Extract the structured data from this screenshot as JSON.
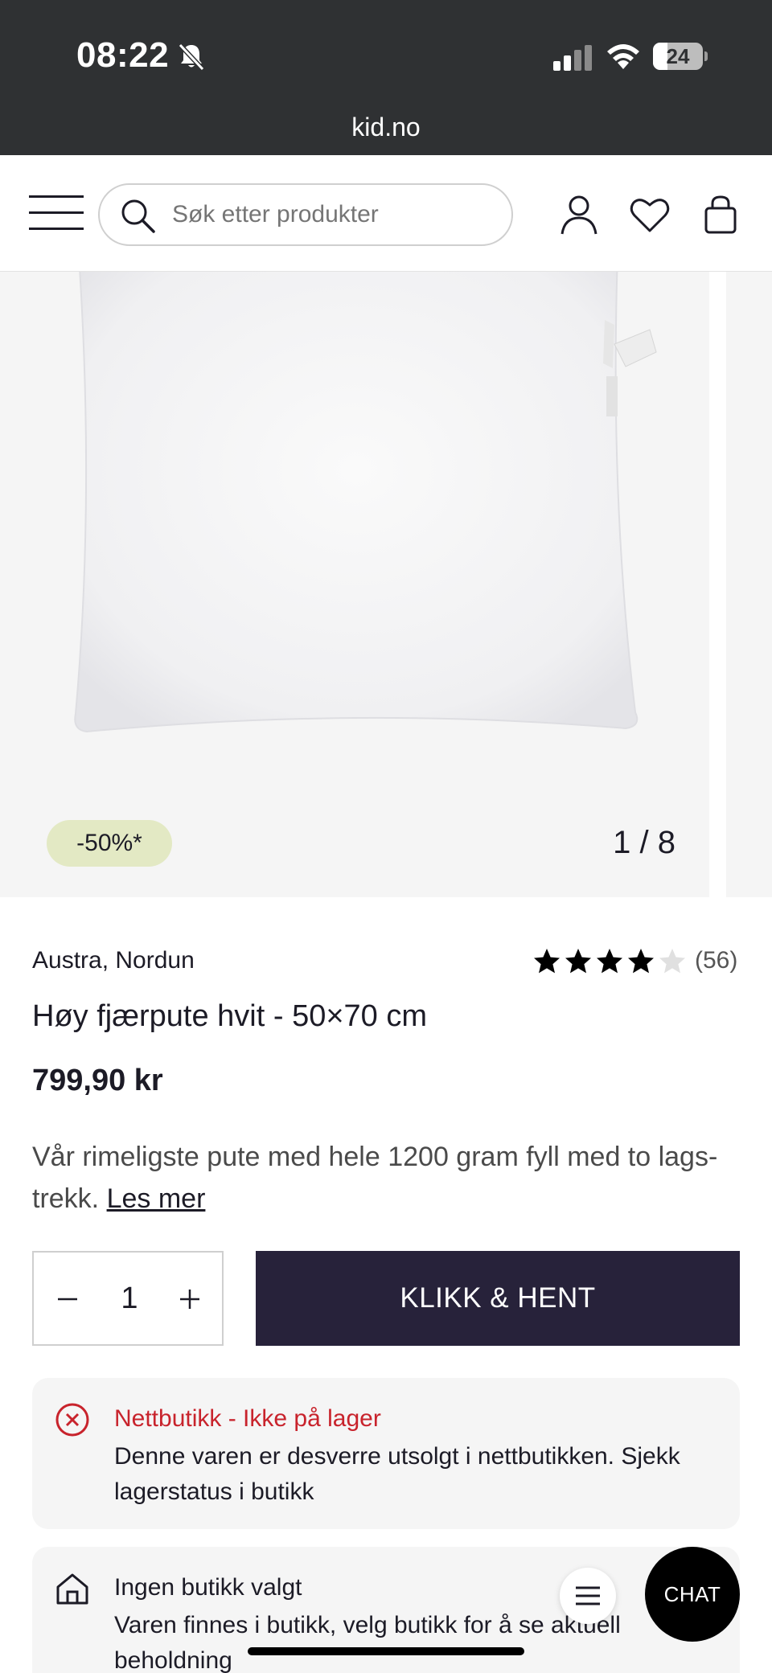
{
  "status_bar": {
    "time": "08:22",
    "battery": "24",
    "url": "kid.no"
  },
  "header": {
    "search_placeholder": "Søk etter produkter"
  },
  "gallery": {
    "discount_badge": "-50%*",
    "counter": "1 / 8"
  },
  "product": {
    "brand": "Austra, Nordun",
    "rating": 4,
    "rating_max": 5,
    "review_count": "(56)",
    "title": "Høy fjærpute hvit - 50×70 cm",
    "price": "799,90 kr",
    "description": "Vår rimeligste pute med hele 1200 gram fyll med to lags-trekk.",
    "read_more": "Les mer"
  },
  "purchase": {
    "quantity": "1",
    "cta_label": "KLIKK & HENT"
  },
  "stock_online": {
    "title": "Nettbutikk - Ikke på lager",
    "text": "Denne varen er desverre utsolgt i nettbutikken. Sjekk lagerstatus i butikk"
  },
  "store_status": {
    "title": "Ingen butikk valgt",
    "text": "Varen finnes i butikk, velg butikk for å se aktuell beholdning"
  },
  "chat": {
    "label": "CHAT"
  },
  "colors": {
    "status_bar_bg": "#2f3133",
    "cta_bg": "#27223a",
    "error_red": "#c8232c",
    "discount_bg": "#e3e9c4",
    "panel_bg": "#f5f5f5"
  },
  "icons": [
    "bell-muted-icon",
    "signal-icon",
    "wifi-icon",
    "battery-icon",
    "hamburger-icon",
    "search-icon",
    "user-icon",
    "heart-icon",
    "bag-icon",
    "star-icon",
    "minus-icon",
    "plus-icon",
    "error-circle-icon",
    "store-icon",
    "menu-icon"
  ]
}
